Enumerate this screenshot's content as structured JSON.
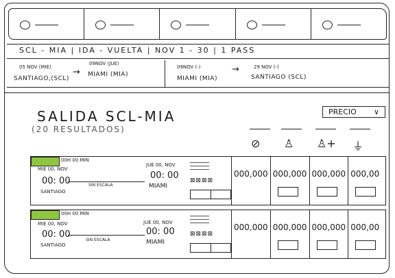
{
  "steps": [
    {
      "label": ""
    },
    {
      "label": ""
    },
    {
      "label": ""
    },
    {
      "label": ""
    },
    {
      "label": ""
    }
  ],
  "summary": "SCL - MIA  | IDA - VUELTA | NOV 1 - 30 | 1 PASS",
  "legs": [
    {
      "date": "05 NOV (MIE)",
      "city": "SANTIAGO,(SCL)"
    },
    {
      "date": "09NOV (JUE)",
      "city": "MIAMI (MIA)"
    },
    {
      "date": "09NOV (-)",
      "city": "MIAMI (MIA)"
    },
    {
      "date": "29 NOV (-)",
      "city": "SANTIAGO (SCL)"
    }
  ],
  "title": "SALIDA SCL-MIA",
  "count": "(20 RESULTADOS)",
  "sort_label": "PRECIO",
  "cabin_icons": [
    "no-bag-icon",
    "seat-icon",
    "seat-plus-icon",
    "flat-bed-icon"
  ],
  "results": [
    {
      "duration": "00H 00 MIN",
      "dep_date": "MIE 00, NOV",
      "dep_time": "00: 00",
      "dep_city": "SANTIAGO",
      "stops": "SIN ESCALA",
      "arr_date": "JUE 00, NOV",
      "arr_time": "00: 00",
      "arr_city": "MIAMI",
      "fares": [
        "000,000",
        "000,000",
        "000,000",
        "000,00"
      ]
    },
    {
      "duration": "00H 00 MIN",
      "dep_date": "MIE 00, NOV",
      "dep_time": "00: 00",
      "dep_city": "SANTIAGO",
      "stops": "SIN ESCALA",
      "arr_date": "JUE 00, NOV",
      "arr_time": "00: 00",
      "arr_city": "MIAMI",
      "fares": [
        "000,000",
        "000,000",
        "000,000",
        "000,00"
      ]
    }
  ],
  "colors": {
    "accent": "#8ec63f"
  }
}
